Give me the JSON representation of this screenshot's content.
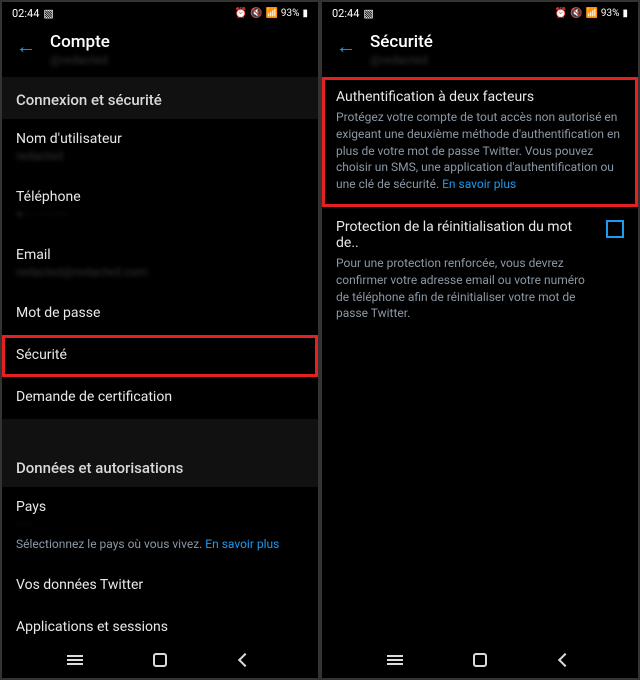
{
  "status": {
    "time": "02:44",
    "battery": "93%"
  },
  "left": {
    "title": "Compte",
    "subtitle": "@redacted",
    "section1": "Connexion et sécurité",
    "items1": {
      "username": "Nom d'utilisateur",
      "username_sub": "redacted",
      "phone": "Téléphone",
      "phone_sub": "+·· · ·· ·· ····",
      "email": "Email",
      "email_sub": "redacted@redacted.com",
      "password": "Mot de passe",
      "security": "Sécurité",
      "verification": "Demande de certification"
    },
    "section2": "Données et autorisations",
    "items2": {
      "country": "Pays",
      "country_sub": "·····",
      "country_hint": "Sélectionnez le pays où vous vivez. ",
      "country_link": "En savoir plus",
      "your_data": "Vos données Twitter",
      "apps": "Applications et sessions"
    }
  },
  "right": {
    "title": "Sécurité",
    "subtitle": "@redacted",
    "twofa": {
      "title": "Authentification à deux facteurs",
      "desc": "Protégez votre compte de tout accès non autorisé en exigeant une deuxième méthode d'authentification en plus de votre mot de passe Twitter. Vous pouvez choisir un SMS, une application d'authentification ou une clé de sécurité. ",
      "link": "En savoir plus"
    },
    "pwreset": {
      "title": "Protection de la réinitialisation du mot de..",
      "desc": "Pour une protection renforcée, vous devrez confirmer votre adresse email ou votre numéro de téléphone afin de réinitialiser votre mot de passe Twitter."
    }
  }
}
